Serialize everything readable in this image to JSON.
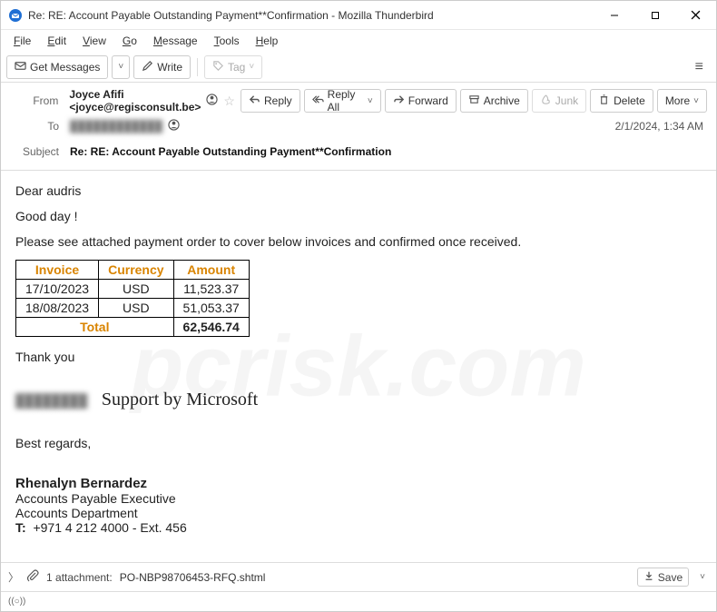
{
  "window": {
    "title": "Re: RE: Account Payable Outstanding Payment**Confirmation - Mozilla Thunderbird"
  },
  "menu": {
    "file": "File",
    "edit": "Edit",
    "view": "View",
    "go": "Go",
    "message": "Message",
    "tools": "Tools",
    "help": "Help"
  },
  "toolbar": {
    "get_messages": "Get Messages",
    "write": "Write",
    "tag": "Tag"
  },
  "actions": {
    "reply": "Reply",
    "reply_all": "Reply All",
    "forward": "Forward",
    "archive": "Archive",
    "junk": "Junk",
    "delete": "Delete",
    "more": "More"
  },
  "headers": {
    "from_label": "From",
    "from_value": "Joyce Afifi <joyce@regisconsult.be>",
    "to_label": "To",
    "to_value": "████████████",
    "subject_label": "Subject",
    "subject_value": "Re: RE: Account Payable Outstanding Payment**Confirmation",
    "date": "2/1/2024, 1:34 AM"
  },
  "body": {
    "greeting": "Dear  audris",
    "good_day": "Good day !",
    "intro": "Please see attached payment order to cover below invoices and confirmed once received.",
    "thank_you": "Thank you",
    "support": "Support by Microsoft",
    "regards": "Best regards,",
    "sig_name": "Rhenalyn Bernardez",
    "sig_title": "Accounts Payable Executive",
    "sig_dept": "Accounts Department",
    "sig_phone_label": "T:",
    "sig_phone": "+971 4 212 4000 - Ext. 456"
  },
  "table": {
    "h_invoice": "Invoice",
    "h_currency": "Currency",
    "h_amount": "Amount",
    "rows": [
      {
        "invoice": "17/10/2023",
        "currency": "USD",
        "amount": "11,523.37"
      },
      {
        "invoice": "18/08/2023",
        "currency": "USD",
        "amount": "51,053.37"
      }
    ],
    "total_label": "Total",
    "total_value": "62,546.74"
  },
  "attachment": {
    "count_text": "1 attachment:",
    "filename": "PO-NBP98706453-RFQ.shtml",
    "save": "Save"
  },
  "status": {
    "icon": "((○))"
  },
  "watermark": "pcrisk.com"
}
